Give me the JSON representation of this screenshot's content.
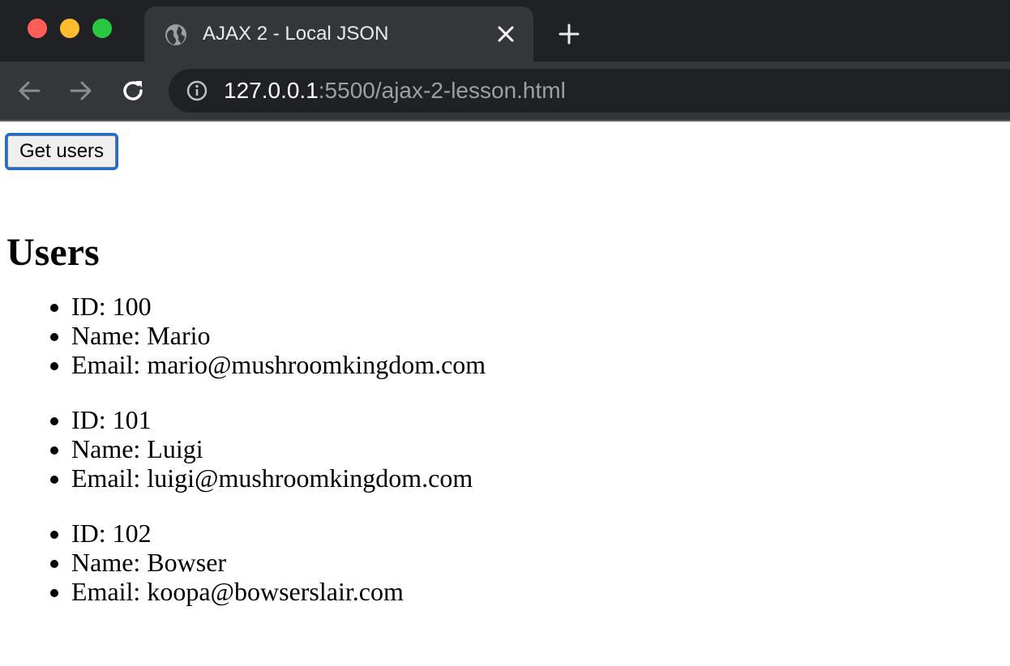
{
  "browser": {
    "tab_title": "AJAX 2 - Local JSON",
    "url_host": "127.0.0.1",
    "url_rest": ":5500/ajax-2-lesson.html"
  },
  "page": {
    "button_label": "Get users",
    "heading": "Users",
    "users": [
      {
        "id": "ID: 100",
        "name": "Name: Mario",
        "email": "Email: mario@mushroomkingdom.com"
      },
      {
        "id": "ID: 101",
        "name": "Name: Luigi",
        "email": "Email: luigi@mushroomkingdom.com"
      },
      {
        "id": "ID: 102",
        "name": "Name: Bowser",
        "email": "Email: koopa@bowserslair.com"
      }
    ]
  },
  "colors": {
    "titlebar_bg": "#202124",
    "toolbar_bg": "#35363a",
    "close_red": "#ff5f57",
    "minimize_yellow": "#febc2e",
    "zoom_green": "#28c840",
    "focus_ring": "#1a6fd6"
  },
  "icons": {
    "window_close": "close-window-icon",
    "window_minimize": "minimize-window-icon",
    "window_zoom": "zoom-window-icon",
    "tab_favicon": "globe-icon",
    "tab_close": "close-icon",
    "new_tab": "plus-icon",
    "back": "arrow-left-icon",
    "forward": "arrow-right-icon",
    "reload": "reload-icon",
    "site_info": "info-icon"
  }
}
